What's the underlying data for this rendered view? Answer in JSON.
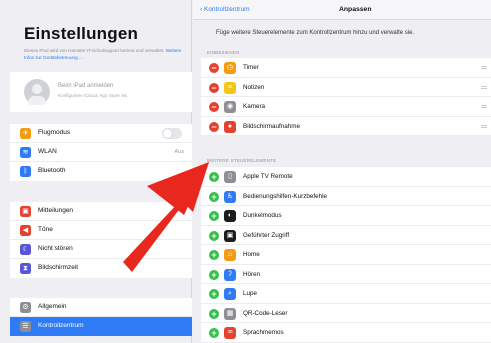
{
  "sidebar": {
    "title": "Einstellungen",
    "note": "Dieses iPad wird von Hamster IT-Schulsupport betreut und verwaltet.",
    "note_link": "Weitere Infos zur Gerätebetreuung …",
    "account_name": "Beim iPad anmelden",
    "account_sub": "Konfiguriere iCloud, App Store etc.",
    "group1": [
      {
        "label": "Flugmodus",
        "icon": "airplane-icon",
        "color": "#f39c12"
      },
      {
        "label": "WLAN",
        "icon": "wifi-icon",
        "color": "#2f7bf5",
        "value": "Aus"
      },
      {
        "label": "Bluetooth",
        "icon": "bluetooth-icon",
        "color": "#2f7bf5"
      }
    ],
    "group2": [
      {
        "label": "Mitteilungen",
        "icon": "notifications-icon",
        "color": "#e5412f"
      },
      {
        "label": "Töne",
        "icon": "sounds-icon",
        "color": "#e5412f"
      },
      {
        "label": "Nicht stören",
        "icon": "moon-icon",
        "color": "#5856d6"
      },
      {
        "label": "Bildschirmzeit",
        "icon": "hourglass-icon",
        "color": "#5856d6"
      }
    ],
    "group3": [
      {
        "label": "Allgemein",
        "icon": "gear-icon",
        "color": "#8e8e93"
      },
      {
        "label": "Kontrollzentrum",
        "icon": "control-center-icon",
        "color": "#8e8e93"
      }
    ]
  },
  "content": {
    "back_label": "Kontrollzentrum",
    "page_title": "Anpassen",
    "description": "Füge weitere Steuerelemente zum Kontrollzentrum hinzu und verwalte sie.",
    "included_header": "EINBEZIEHEN",
    "included": [
      {
        "label": "Timer",
        "icon": "timer-icon",
        "color": "#f39c12"
      },
      {
        "label": "Notizen",
        "icon": "notes-icon",
        "color": "#f5c518"
      },
      {
        "label": "Kamera",
        "icon": "camera-icon",
        "color": "#8e8e93"
      },
      {
        "label": "Bildschirmaufnahme",
        "icon": "screen-recording-icon",
        "color": "#e5412f"
      }
    ],
    "more_header": "WEITERE STEUERELEMENTE",
    "more": [
      {
        "label": "Apple TV Remote",
        "icon": "remote-icon",
        "color": "#8e8e93"
      },
      {
        "label": "Bedienungshilfen-Kurzbefehle",
        "icon": "accessibility-icon",
        "color": "#2f7bf5"
      },
      {
        "label": "Dunkelmodus",
        "icon": "dark-mode-icon",
        "color": "#1c1c1e"
      },
      {
        "label": "Geführter Zugriff",
        "icon": "lock-icon",
        "color": "#1c1c1e"
      },
      {
        "label": "Home",
        "icon": "home-icon",
        "color": "#f39c12"
      },
      {
        "label": "Hören",
        "icon": "ear-icon",
        "color": "#2f7bf5"
      },
      {
        "label": "Lupe",
        "icon": "magnifier-icon",
        "color": "#2f7bf5"
      },
      {
        "label": "QR-Code-Leser",
        "icon": "qr-icon",
        "color": "#8e8e93"
      },
      {
        "label": "Sprachmemos",
        "icon": "voice-memo-icon",
        "color": "#e5412f"
      }
    ]
  },
  "arrow_color": "#e8281e"
}
